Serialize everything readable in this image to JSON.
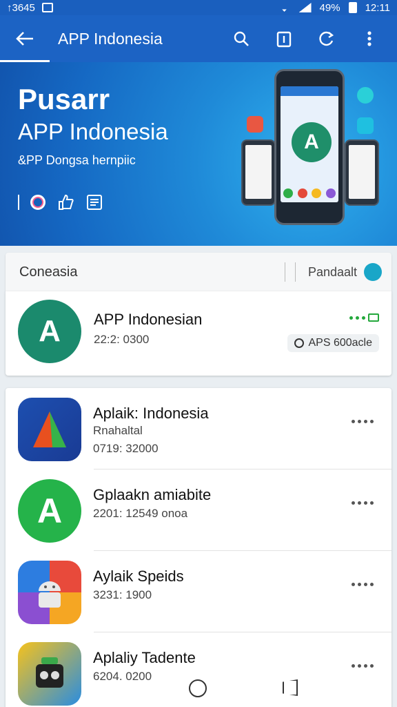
{
  "status_bar": {
    "left_text": "↑3645",
    "battery": "49%",
    "time": "12:11"
  },
  "app_bar": {
    "title": "APP Indonesia"
  },
  "hero": {
    "title": "Pusarr",
    "heading": "APP Indonesia",
    "subtitle": "&PP Dongsa hernpiic"
  },
  "list_header": {
    "label": "Coneasia",
    "right_label": "Pandaalt"
  },
  "featured": {
    "name": "APP Indonesian",
    "meta": "22:2: 0300",
    "chip": "APS 600acle"
  },
  "apps": [
    {
      "name": "Aplaik: Indonesia",
      "sub": "Rnahaltal",
      "meta": "0719: 32000"
    },
    {
      "name": "Gplaakn amiabite",
      "meta": "2201: 12549 onoa"
    },
    {
      "name": "Aylaik Speids",
      "meta": "3231: 1900"
    },
    {
      "name": "Aplaliy Tadente",
      "meta": "6204. 0200"
    }
  ],
  "colors": {
    "primary": "#1c63c4",
    "accent_green": "#24a83c"
  },
  "icons": [
    "back-arrow-icon",
    "search-icon",
    "clipboard-icon",
    "refresh-icon",
    "more-vert-icon"
  ]
}
